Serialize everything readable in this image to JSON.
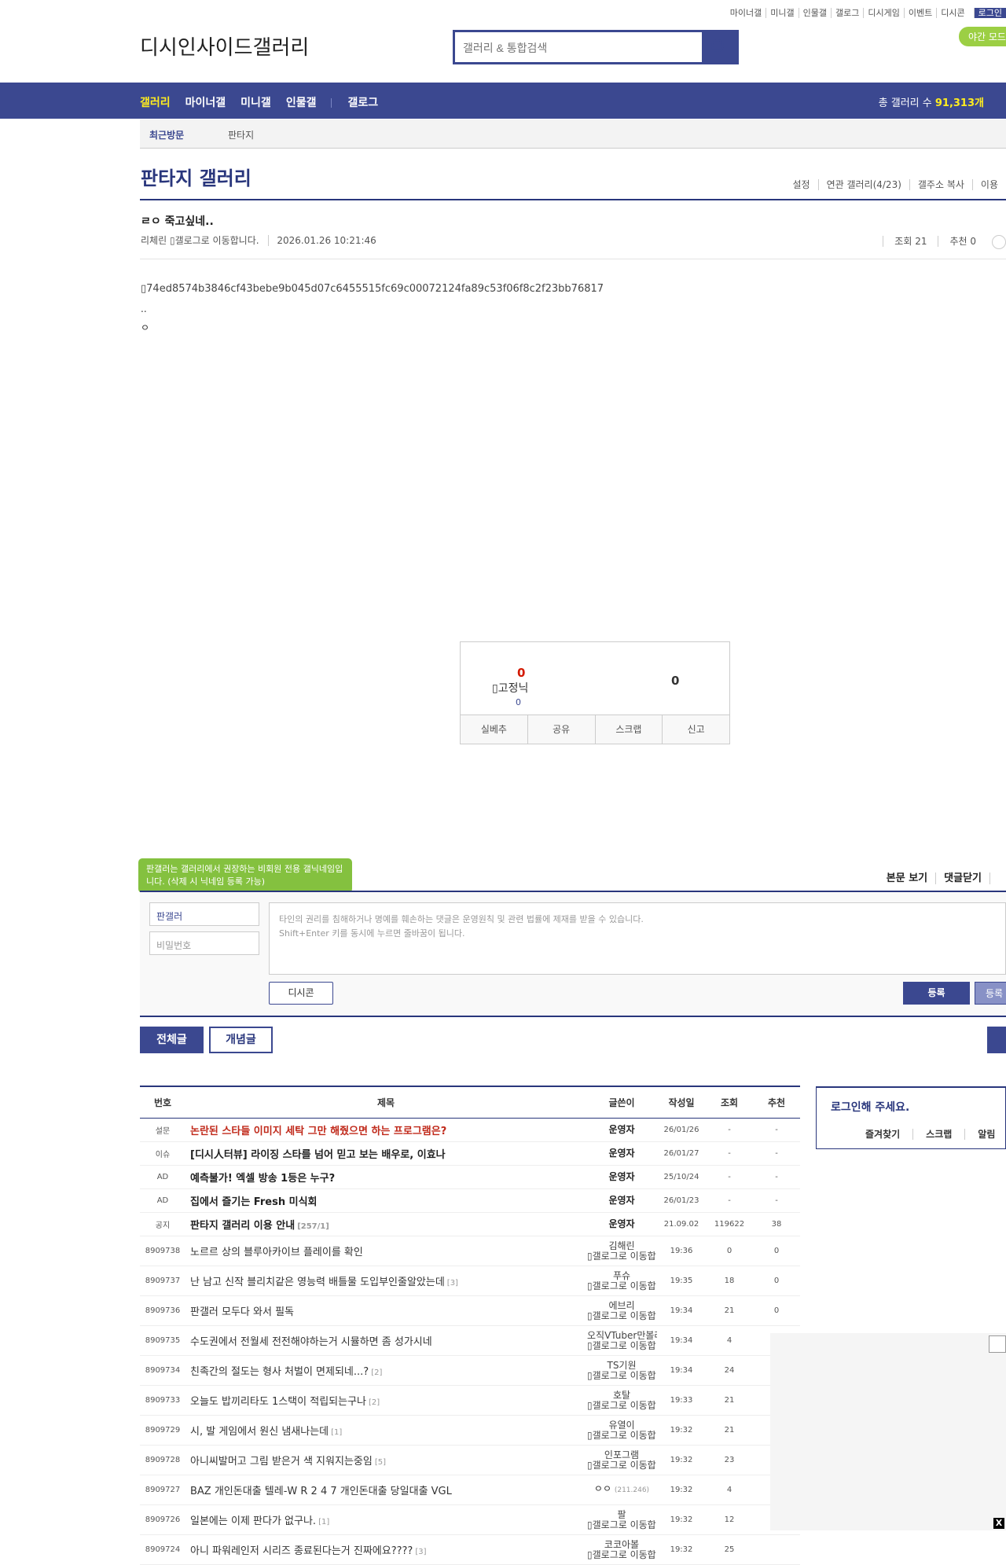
{
  "top_links": [
    "마이너갤",
    "미니갤",
    "인물갤",
    "갤로그",
    "디시게임",
    "이벤트",
    "디시콘"
  ],
  "login_label": "로그인",
  "night_mode": "야간 모드",
  "logo_text": "디시인사이드갤러리",
  "search": {
    "placeholder": "갤러리 & 통합검색"
  },
  "gnb": {
    "items": [
      "갤러리",
      "마이너갤",
      "미니갤",
      "인물갤",
      "갤로그"
    ],
    "total_label": "총 갤러리 수",
    "total_value": "91,313개"
  },
  "recent": {
    "label": "최근방문",
    "gallery": "판타지"
  },
  "gallery": {
    "title": "판타지 갤러리",
    "menu": [
      "설정",
      "연관 갤러리(4/23)",
      "갤주소 복사",
      "이용"
    ]
  },
  "post": {
    "title": "ㄹㅇ 죽고싶네..",
    "author": "리체린",
    "gallog_alt": "갤로그로 이동합니다.",
    "date": "2026.01.26 10:21:46",
    "views": "조회 21",
    "recommend": "추천 0",
    "image_alt": "74ed8574b3846cf43bebe9b045d07c6455515fc69c00072124fa89c53f06f8c2f23bb76817",
    "lines": [
      "..",
      "ㅇ"
    ]
  },
  "recommend_box": {
    "up_count": "0",
    "fixed_label": "고정닉",
    "fixed_count": "0",
    "down_count": "0",
    "buttons": [
      "실베추",
      "공유",
      "스크랩",
      "신고"
    ]
  },
  "comment": {
    "tooltip": "판갤러는 갤러리에서 권장하는 비회원 전용 갤닉네임입니다. (삭제 시 닉네임 등록 가능)",
    "header_links": [
      "본문 보기",
      "댓글닫기"
    ],
    "name_value": "판갤러",
    "password_placeholder": "비밀번호",
    "textarea_line1": "타인의 권리를 침해하거나 명예를 훼손하는 댓글은 운영원칙 및 관련 법률에 제재를 받을 수 있습니다.",
    "textarea_line2": "Shift+Enter 키를 동시에 누르면 줄바꿈이 됩니다.",
    "dccon_label": "디시콘",
    "submit_label": "등록",
    "submit2_label": "등록"
  },
  "list_tabs": {
    "all": "전체글",
    "recommended": "개념글"
  },
  "table": {
    "headers": [
      "번호",
      "제목",
      "글쓴이",
      "작성일",
      "조회",
      "추천"
    ],
    "rows": [
      {
        "no": "설문",
        "title": "논란된 스타들 이미지 세탁 그만 해줬으면 하는 프로그램은?",
        "reply": "",
        "writer": "운영자",
        "gallog": "",
        "date": "26/01/26",
        "views": "-",
        "rec": "-",
        "style": "red",
        "kind": "notice"
      },
      {
        "no": "이슈",
        "title": "[디시人터뷰] 라이징 스타를 넘어 믿고 보는 배우로, 이효나",
        "reply": "",
        "writer": "운영자",
        "gallog": "",
        "date": "26/01/27",
        "views": "-",
        "rec": "-",
        "style": "bold",
        "kind": "notice"
      },
      {
        "no": "AD",
        "title": "예측불가! 엑셀 방송 1등은 누구?",
        "reply": "",
        "writer": "운영자",
        "gallog": "",
        "date": "25/10/24",
        "views": "-",
        "rec": "-",
        "style": "bold",
        "kind": "notice"
      },
      {
        "no": "AD",
        "title": "집에서 즐기는 Fresh 미식회",
        "reply": "",
        "writer": "운영자",
        "gallog": "",
        "date": "26/01/23",
        "views": "-",
        "rec": "-",
        "style": "bold",
        "kind": "notice"
      },
      {
        "no": "공지",
        "title": "판타지 갤러리 이용 안내",
        "reply": "[257/1]",
        "writer": "운영자",
        "gallog": "",
        "date": "21.09.02",
        "views": "119622",
        "rec": "38",
        "style": "bold",
        "kind": "notice"
      },
      {
        "no": "8909738",
        "title": "노르르 상의 블루아카이브 플레이를 확인",
        "reply": "",
        "writer": "김해린",
        "gallog": "갤로그로 이동합니다.",
        "date": "19:36",
        "views": "0",
        "rec": "0",
        "style": "",
        "kind": "normal"
      },
      {
        "no": "8909737",
        "title": "난 남고 신작 블리치같은 영능력 배틀물 도입부인줄알았는데",
        "reply": "[3]",
        "writer": "푸슈",
        "gallog": "갤로그로 이동합니다.",
        "date": "19:35",
        "views": "18",
        "rec": "0",
        "style": "",
        "kind": "normal"
      },
      {
        "no": "8909736",
        "title": "판갤러 모두다 와서 필독",
        "reply": "",
        "writer": "에브리",
        "gallog": "갤로그로 이동합니다.",
        "date": "19:34",
        "views": "21",
        "rec": "0",
        "style": "",
        "kind": "normal"
      },
      {
        "no": "8909735",
        "title": "수도권에서 전월세 전전해야하는거 시뮬하면 좀 성가시네",
        "reply": "",
        "writer": "오직VTuber만볼래",
        "gallog": "갤로그로 이동합니다.",
        "date": "19:34",
        "views": "4",
        "rec": "1",
        "style": "",
        "kind": "normal"
      },
      {
        "no": "8909734",
        "title": "친족간의 절도는 형사 처벌이 면제되네...?",
        "reply": "[2]",
        "writer": "TS기원",
        "gallog": "갤로그로 이동합니다.",
        "date": "19:34",
        "views": "24",
        "rec": "",
        "style": "",
        "kind": "normal"
      },
      {
        "no": "8909733",
        "title": "오늘도 밥끼리타도 1스택이 적립되는구나",
        "reply": "[2]",
        "writer": "호탈",
        "gallog": "갤로그로 이동합니다.",
        "date": "19:33",
        "views": "21",
        "rec": "",
        "style": "",
        "kind": "normal"
      },
      {
        "no": "8909729",
        "title": "시, 발 게임에서 원신 냄새나는데",
        "reply": "[1]",
        "writer": "유열이",
        "gallog": "갤로그로 이동합니다.",
        "date": "19:32",
        "views": "21",
        "rec": "",
        "style": "",
        "kind": "normal"
      },
      {
        "no": "8909728",
        "title": "아니씨발머고 그림 받은거 색 지워지는중임",
        "reply": "[5]",
        "writer": "인포그램",
        "gallog": "갤로그로 이동합니다.",
        "date": "19:32",
        "views": "23",
        "rec": "",
        "style": "",
        "kind": "normal"
      },
      {
        "no": "8909727",
        "title": "BAZ 개인돈대출 텔레-W R 2 4 7 개인돈대출 당일대출 VGL",
        "reply": "",
        "writer": "ㅇㅇ",
        "ip": "(211.246)",
        "gallog": "",
        "date": "19:32",
        "views": "4",
        "rec": "",
        "style": "",
        "kind": "ip"
      },
      {
        "no": "8909726",
        "title": "일본에는 이제 판다가 없구나.",
        "reply": "[1]",
        "writer": "팔",
        "gallog": "갤로그로 이동합니다.",
        "date": "19:32",
        "views": "12",
        "rec": "",
        "style": "",
        "kind": "normal"
      },
      {
        "no": "8909724",
        "title": "아니 파워레인저 시리즈 종료된다는거 진짜에요????",
        "reply": "[3]",
        "writer": "코코아볼",
        "gallog": "갤로그로 이동합니다.",
        "date": "19:32",
        "views": "25",
        "rec": "",
        "style": "",
        "kind": "normal"
      }
    ]
  },
  "login_box": {
    "title": "로그인해 주세요.",
    "links": [
      "즐겨찾기",
      "스크랩",
      "알림"
    ]
  },
  "colors": {
    "brand": "#3b4890",
    "brand_dark": "#29367c",
    "accent_yellow": "#ffed1f",
    "tooltip_green": "#84c13f"
  }
}
